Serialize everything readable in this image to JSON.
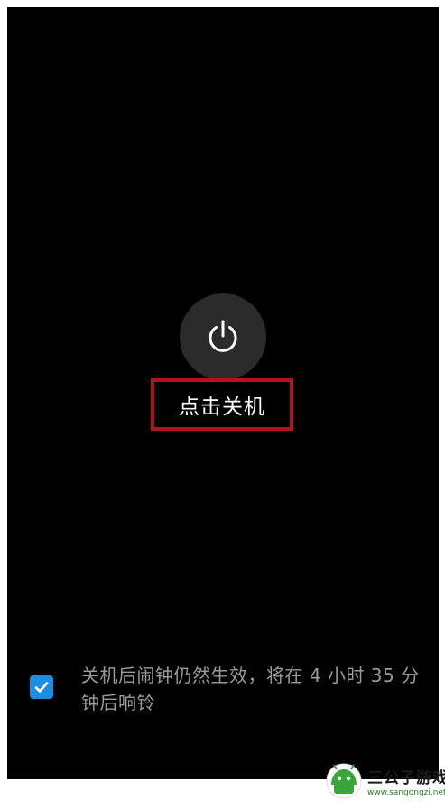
{
  "power_menu": {
    "action_label": "点击关机",
    "alarm_note": "关机后闹钟仍然生效，将在 4 小时 35 分钟后响铃",
    "alarm_checkbox_checked": true
  },
  "icons": {
    "power": "power-icon",
    "check": "check-icon"
  },
  "colors": {
    "background": "#000000",
    "power_button_bg": "#2b2b2b",
    "highlight": "#b5131b",
    "checkbox": "#1d8ce3"
  },
  "watermark": {
    "title": "三公子游戏网",
    "url": "www.sangongzi.net"
  }
}
